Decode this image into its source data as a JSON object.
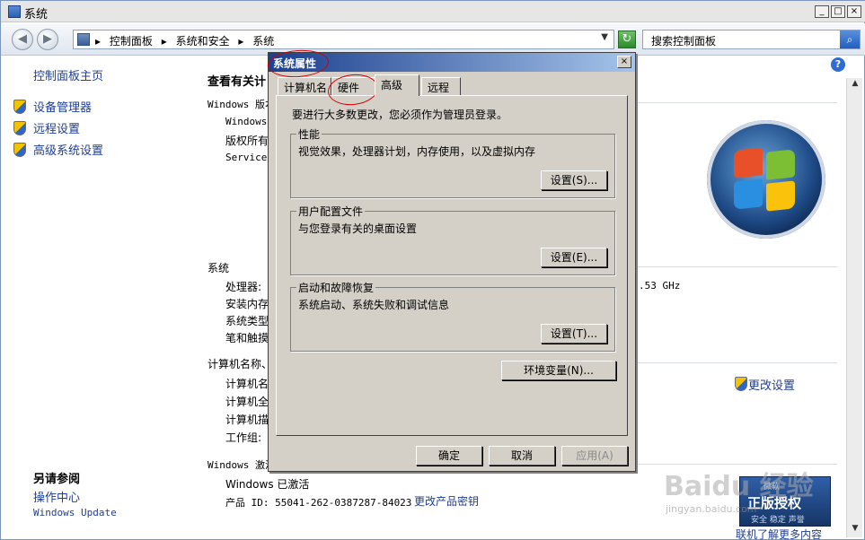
{
  "window": {
    "title": "系统",
    "min": "_",
    "max": "□",
    "close": "×"
  },
  "address": {
    "crumbs": [
      "控制面板",
      "系统和安全",
      "系统"
    ],
    "sep": "▸",
    "search_placeholder": "搜索控制面板"
  },
  "sidebar": {
    "home": "控制面板主页",
    "items": [
      "设备管理器",
      "远程设置",
      "高级系统设置"
    ],
    "see_also_title": "另请参阅",
    "see_also": [
      "操作中心",
      "Windows Update"
    ]
  },
  "main": {
    "heading": "查看有关计",
    "edition_label": "Windows 版本",
    "edition_lines": [
      "Windows",
      "版权所有",
      "Service"
    ],
    "system_label": "系统",
    "system_rows": [
      "处理器:",
      "安装内存",
      "系统类型",
      "笔和触摸"
    ],
    "cpu_suffix": ".53 GHz",
    "computer_label": "计算机名称、",
    "computer_rows": [
      "计算机名",
      "计算机全",
      "计算机描",
      "工作组:"
    ],
    "change_settings": "更改设置",
    "activation_label": "Windows 激活",
    "activated": "Windows 已激活",
    "product_id": "产品 ID: 55041-262-0387287-84023",
    "change_key": "更改产品密钥",
    "learn_more": "联机了解更多内容",
    "badge_top": "微软",
    "badge_main": "正版授权",
    "badge_sub": "安全 稳定 声誉",
    "watermark": "Baidu 经验",
    "watermark_url": "jingyan.baidu.com"
  },
  "dialog": {
    "title": "系统属性",
    "tabs": [
      "计算机名",
      "硬件",
      "高级",
      "远程"
    ],
    "active_tab": 2,
    "admin_note": "要进行大多数更改，您必须作为管理员登录。",
    "groups": [
      {
        "title": "性能",
        "desc": "视觉效果，处理器计划，内存使用，以及虚拟内存",
        "button": "设置(S)..."
      },
      {
        "title": "用户配置文件",
        "desc": "与您登录有关的桌面设置",
        "button": "设置(E)..."
      },
      {
        "title": "启动和故障恢复",
        "desc": "系统启动、系统失败和调试信息",
        "button": "设置(T)..."
      }
    ],
    "env_button": "环境变量(N)...",
    "ok": "确定",
    "cancel": "取消",
    "apply": "应用(A)"
  },
  "colors": {
    "link": "#1f3f94",
    "dialog_bg": "#d4d0c8",
    "annotation": "#d40000"
  }
}
